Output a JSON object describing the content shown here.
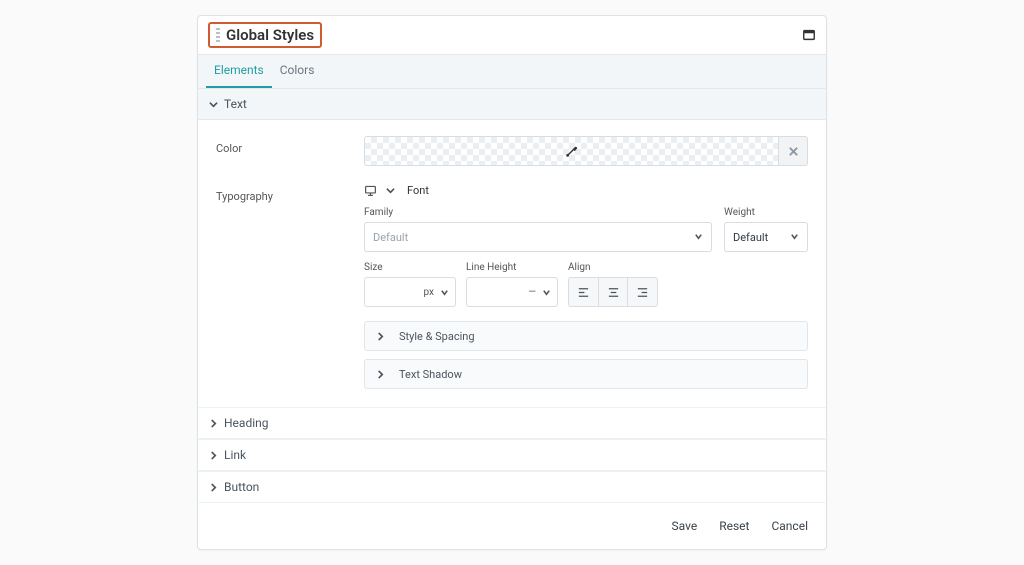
{
  "header": {
    "title": "Global Styles"
  },
  "tabs": {
    "elements": "Elements",
    "colors": "Colors"
  },
  "sections": {
    "text": "Text",
    "heading": "Heading",
    "link": "Link",
    "button": "Button"
  },
  "text": {
    "color_label": "Color",
    "typography_label": "Typography",
    "font_toggle": "Font",
    "family": {
      "label": "Family",
      "value": "Default"
    },
    "weight": {
      "label": "Weight",
      "value": "Default"
    },
    "size": {
      "label": "Size",
      "unit": "px"
    },
    "line_height": {
      "label": "Line Height",
      "unit": "—"
    },
    "align": {
      "label": "Align"
    },
    "style_spacing": "Style & Spacing",
    "text_shadow": "Text Shadow"
  },
  "footer": {
    "save": "Save",
    "reset": "Reset",
    "cancel": "Cancel"
  }
}
